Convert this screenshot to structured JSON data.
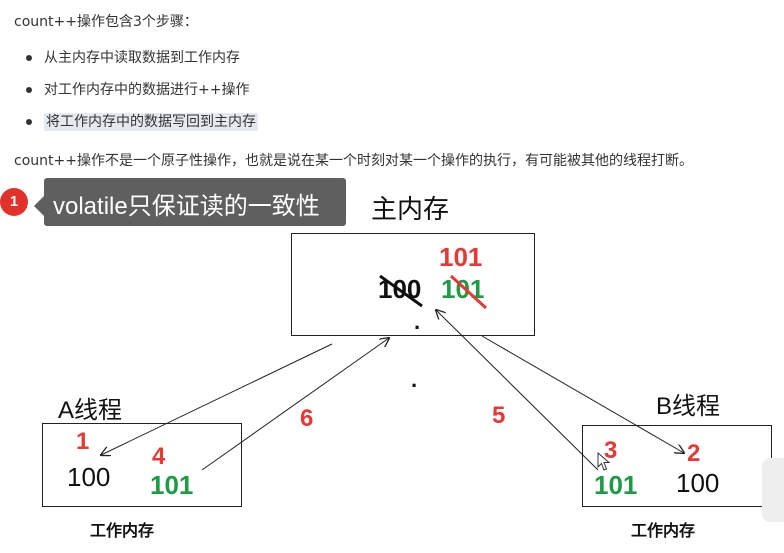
{
  "intro": "count++操作包含3个步骤：",
  "steps": [
    "从主内存中读取数据到工作内存",
    "对工作内存中的数据进行++操作",
    "将工作内存中的数据写回到主内存"
  ],
  "summary": "count++操作不是一个原子性操作，也就是说在某一个时刻对某一个操作的执行，有可能被其他的线程打断。",
  "annotation": {
    "number": "1",
    "text": "volatile只保证读的一致性"
  },
  "diagram": {
    "main_memory": {
      "title": "主内存",
      "old_value": "100",
      "written_top": "101",
      "written_bottom": "101"
    },
    "thread_a": {
      "title": "A线程",
      "step_read": "1",
      "value": "100",
      "step_inc": "4",
      "new_value": "101",
      "footer": "工作内存"
    },
    "thread_b": {
      "title": "B线程",
      "step_inc": "3",
      "new_value": "101",
      "step_read": "2",
      "value": "100",
      "footer": "工作内存"
    },
    "step_write_a": "6",
    "step_write_b": "5",
    "dot_mid": "·",
    "dot_low": "·"
  },
  "colors": {
    "red": "#e53935",
    "green": "#1f9a45",
    "tooltip_bg": "#5f5f5f",
    "badge": "#e0312b"
  }
}
